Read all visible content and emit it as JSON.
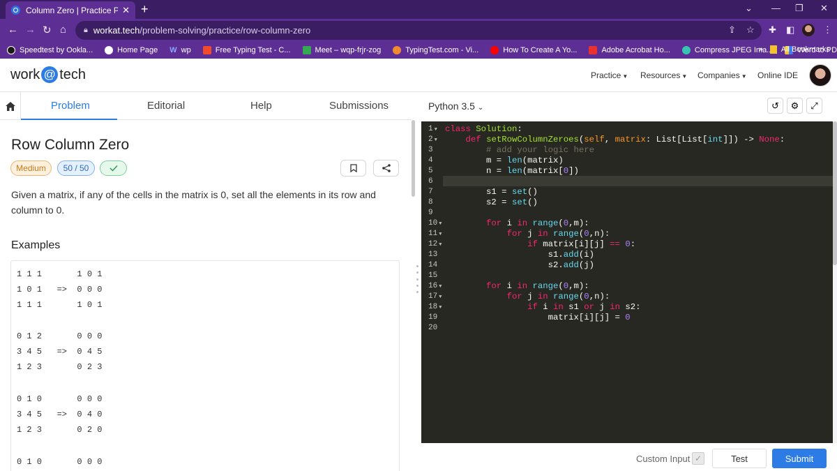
{
  "browser": {
    "tab_title": "Column Zero | Practice Pro",
    "url_host": "workat.tech",
    "url_path": "/problem-solving/practice/row-column-zero",
    "bookmarks": [
      {
        "label": "Speedtest by Ookla...",
        "icon": "speedtest-icon",
        "color": "#1b1b1b"
      },
      {
        "label": "Home Page",
        "icon": "cloud-icon",
        "color": "#ffffff"
      },
      {
        "label": "wp",
        "icon": "wp-icon",
        "color": "#6c8cff"
      },
      {
        "label": "Free Typing Test - C...",
        "icon": "typing-icon",
        "color": "#f24a2c"
      },
      {
        "label": "Meet – wqp-frjr-zog",
        "icon": "meet-icon",
        "color": "#34a853"
      },
      {
        "label": "TypingTest.com - Vi...",
        "icon": "typingtest-icon",
        "color": "#f28b30"
      },
      {
        "label": "How To Create A Yo...",
        "icon": "youtube-icon",
        "color": "#ff0000"
      },
      {
        "label": "Adobe Acrobat Ho...",
        "icon": "acrobat-icon",
        "color": "#e8322f"
      },
      {
        "label": "Compress JPEG Ima...",
        "icon": "compress-icon",
        "color": "#3ac4b4"
      },
      {
        "label": "Word to PDF - Con...",
        "icon": "pdf-icon",
        "color": "#f2c230"
      }
    ],
    "bookmarks_more": "»",
    "all_bookmarks": "All Bookmarks"
  },
  "site": {
    "logo_left": "work",
    "logo_at": "@",
    "logo_right": "tech",
    "nav": [
      "Practice",
      "Resources",
      "Companies",
      "Online IDE"
    ]
  },
  "problem": {
    "tabs": [
      "Problem",
      "Editorial",
      "Help",
      "Submissions"
    ],
    "title": "Row Column Zero",
    "difficulty": "Medium",
    "score": "50 / 50",
    "description": "Given a matrix, if any of the cells in the matrix is 0, set all the elements in its row and column to 0.",
    "examples_heading": "Examples",
    "examples": [
      "1 1 1       1 0 1",
      "1 0 1   =>  0 0 0",
      "1 1 1       1 0 1",
      "",
      "0 1 2       0 0 0",
      "3 4 5   =>  0 4 5",
      "1 2 3       0 2 3",
      "",
      "0 1 0       0 0 0",
      "3 4 5   =>  0 4 0",
      "1 2 3       0 2 0",
      "",
      "0 1 0       0 0 0"
    ]
  },
  "editor": {
    "language": "Python 3.5",
    "fold_lines": [
      1,
      2,
      10,
      11,
      12,
      16,
      17,
      18
    ],
    "line_count": 20,
    "custom_input_label": "Custom Input",
    "test_label": "Test",
    "submit_label": "Submit"
  },
  "colors": {
    "browser_purple": "#5d2f94",
    "accent_blue": "#2d7be5",
    "editor_bg": "#272822"
  }
}
